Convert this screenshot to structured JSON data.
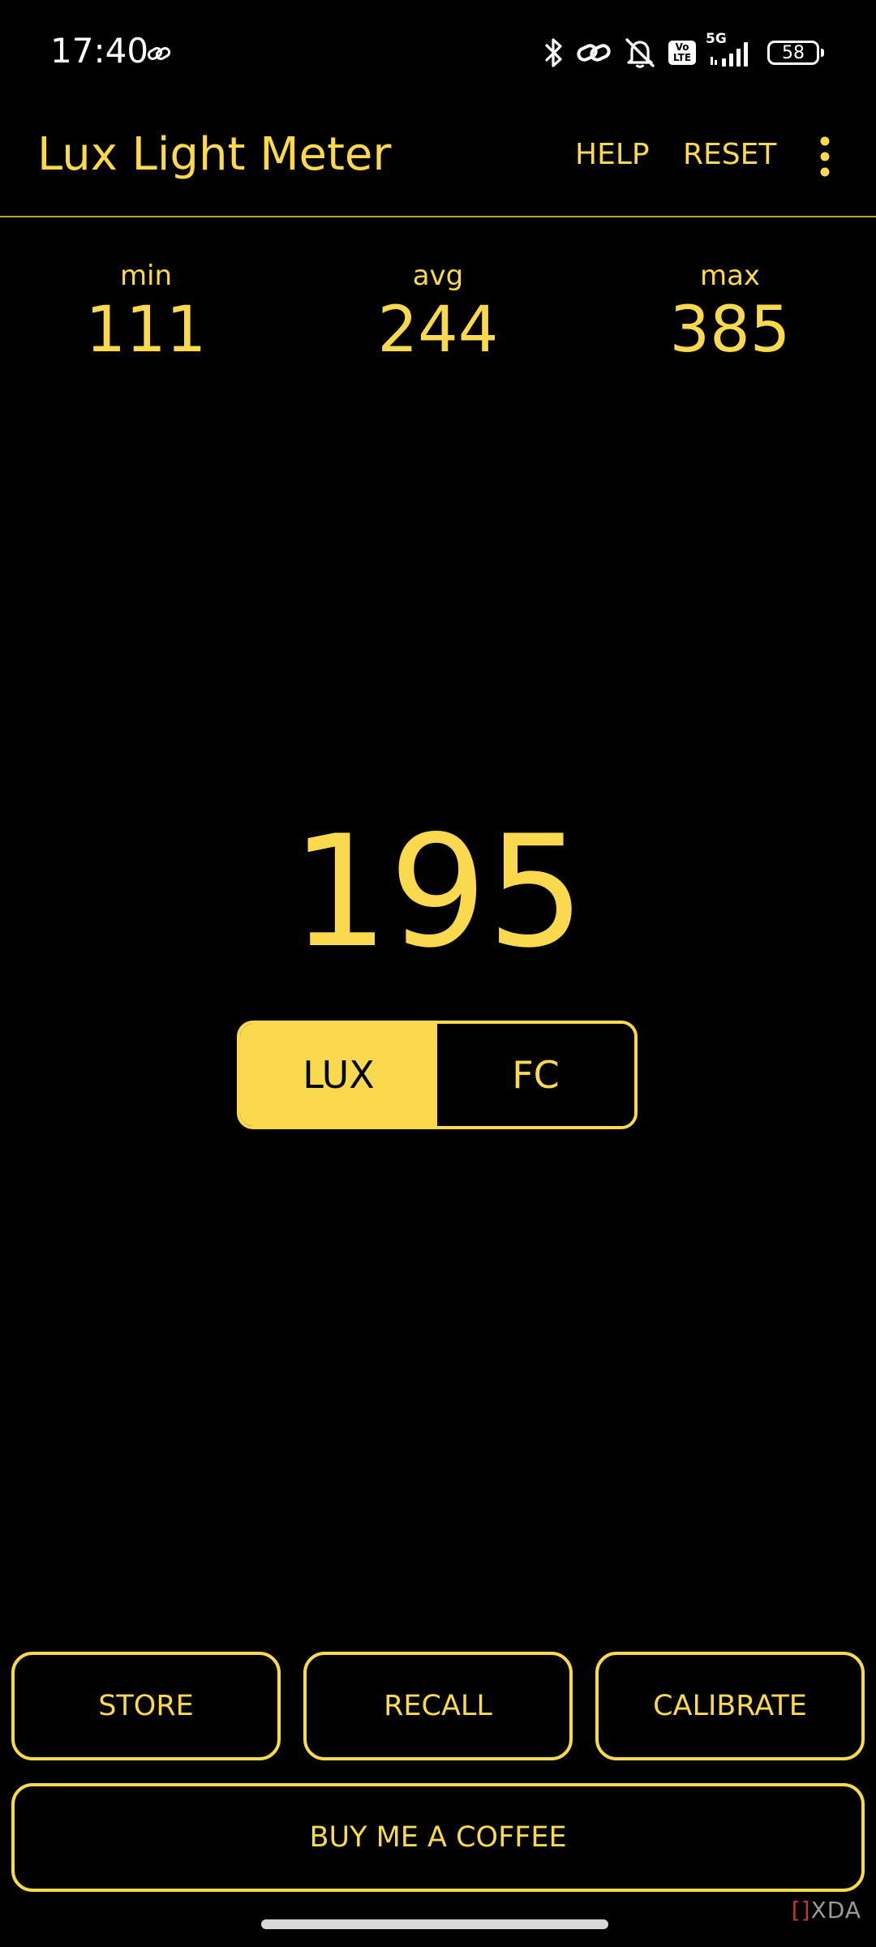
{
  "status_bar": {
    "time": "17:40",
    "network": "5G",
    "volte_top": "Vo",
    "volte_bottom": "LTE",
    "battery": "58",
    "icons": [
      "link-icon",
      "bluetooth-icon",
      "link-icon",
      "bell-off-icon",
      "volte-icon",
      "signal-icon",
      "battery-icon"
    ]
  },
  "app_bar": {
    "title": "Lux Light Meter",
    "help": "HELP",
    "reset": "RESET",
    "overflow_icon": "more-vert-icon"
  },
  "stats": {
    "min_label": "min",
    "min_value": "111",
    "avg_label": "avg",
    "avg_value": "244",
    "max_label": "max",
    "max_value": "385"
  },
  "reading": "195",
  "units": {
    "options": [
      "LUX",
      "FC"
    ],
    "selected": "LUX"
  },
  "buttons": {
    "store": "STORE",
    "recall": "RECALL",
    "calibrate": "CALIBRATE",
    "coffee": "BUY ME A COFFEE"
  },
  "watermark": {
    "bracket": "[]",
    "text": "XDA"
  },
  "colors": {
    "accent": "#FAD94E",
    "background": "#000000",
    "divider": "#B89F3A"
  }
}
